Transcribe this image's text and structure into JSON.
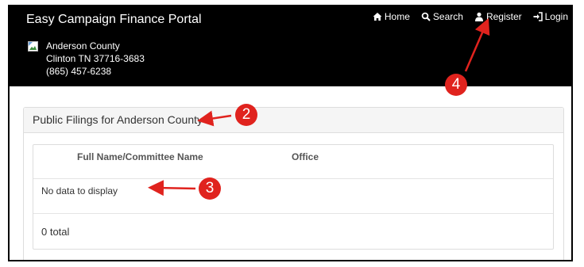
{
  "header": {
    "brand": "Easy Campaign Finance Portal",
    "nav": [
      {
        "label": "Home",
        "icon": "home-icon"
      },
      {
        "label": "Search",
        "icon": "search-icon"
      },
      {
        "label": "Register",
        "icon": "user-icon"
      },
      {
        "label": "Login",
        "icon": "login-icon"
      }
    ],
    "county": {
      "name": "Anderson County",
      "address": "Clinton TN 37716-3683",
      "phone": "(865) 457-6238"
    }
  },
  "panel": {
    "title": "Public Filings for Anderson County",
    "columns": [
      "Full Name/Committee Name",
      "Office"
    ],
    "empty_text": "No data to display",
    "total": "0 total"
  },
  "annotations": [
    "2",
    "3",
    "4"
  ],
  "colors": {
    "callout": "#e0231e",
    "header_bg": "#000000"
  }
}
